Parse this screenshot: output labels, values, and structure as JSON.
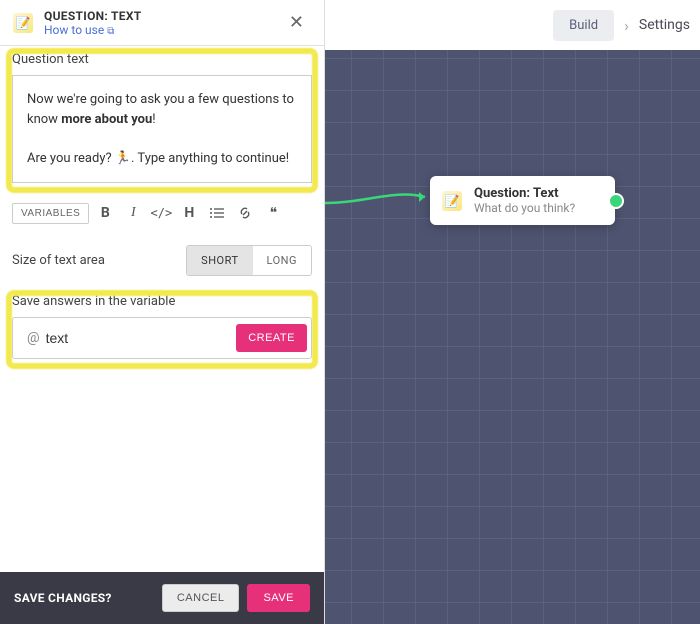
{
  "header": {
    "title": "QUESTION: TEXT",
    "howto": "How to use"
  },
  "question": {
    "label": "Question text",
    "line1_a": "Now we're going to ask you a few questions to know ",
    "line1_b": "more about you",
    "line1_c": "!",
    "line2": "Are you ready? 🏃. Type anything to continue!"
  },
  "toolbar": {
    "variables": "VARIABLES"
  },
  "size": {
    "label": "Size of text area",
    "short": "SHORT",
    "long": "LONG"
  },
  "variable": {
    "label": "Save answers in the variable",
    "value": "text",
    "create": "CREATE"
  },
  "footer": {
    "label": "SAVE CHANGES?",
    "cancel": "CANCEL",
    "save": "SAVE"
  },
  "topbar": {
    "build": "Build",
    "sep": "›",
    "settings": "Settings"
  },
  "node": {
    "title": "Question: Text",
    "sub": "What do you think?"
  }
}
